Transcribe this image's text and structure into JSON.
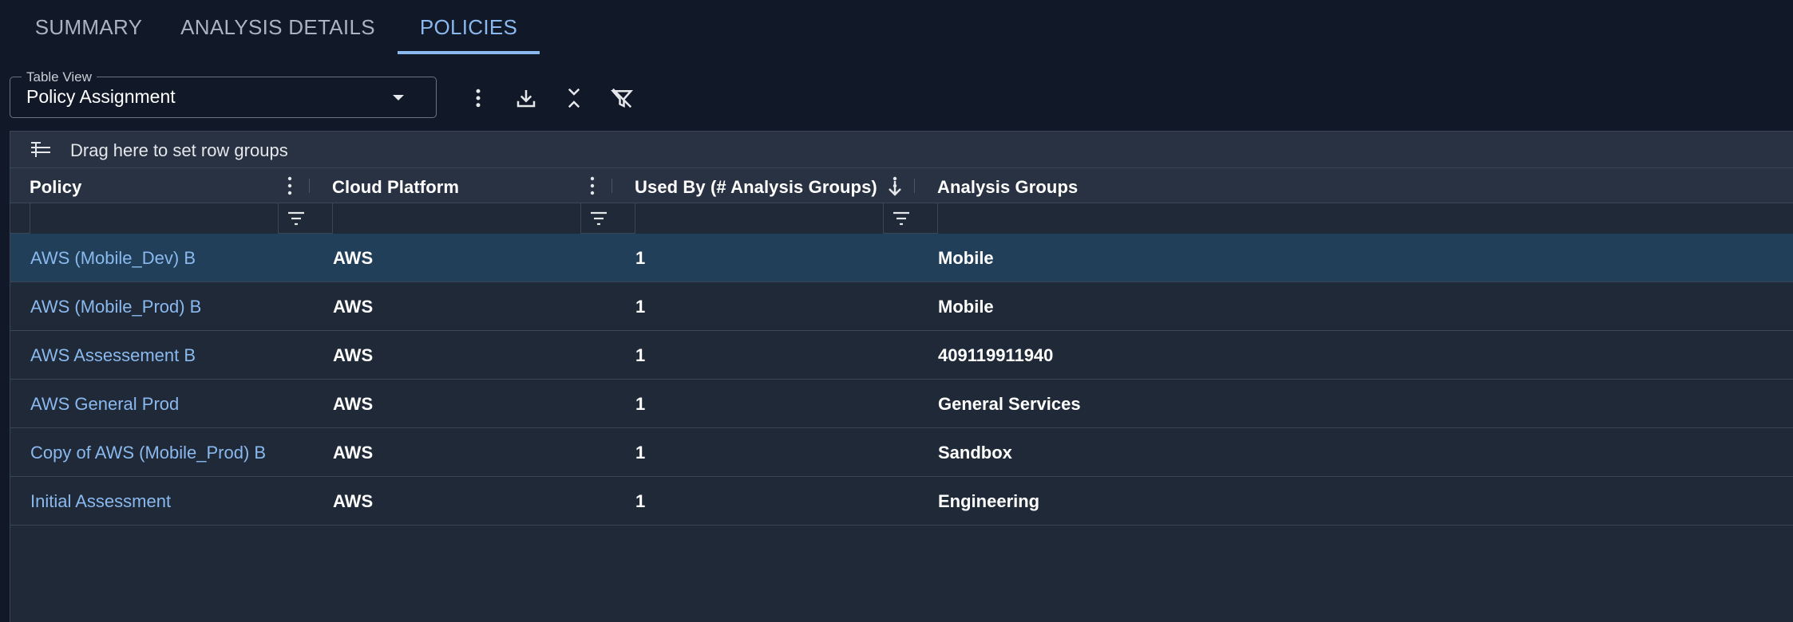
{
  "tabs": [
    {
      "label": "SUMMARY",
      "active": false
    },
    {
      "label": "ANALYSIS DETAILS",
      "active": false
    },
    {
      "label": "POLICIES",
      "active": true
    }
  ],
  "toolbar": {
    "view_legend": "Table View",
    "view_value": "Policy Assignment",
    "icons": [
      "more-vert-icon",
      "download-icon",
      "collapse-icon",
      "clear-filter-icon"
    ]
  },
  "grid": {
    "group_bar_text": "Drag here to set row groups",
    "columns": [
      {
        "label": "Policy"
      },
      {
        "label": "Cloud Platform"
      },
      {
        "label": "Used By (# Analysis Groups)",
        "sort": "desc"
      },
      {
        "label": "Analysis Groups"
      }
    ],
    "rows": [
      {
        "policy": "AWS (Mobile_Dev) B",
        "platform": "AWS",
        "used_by": "1",
        "groups": "Mobile",
        "selected": true
      },
      {
        "policy": "AWS (Mobile_Prod) B",
        "platform": "AWS",
        "used_by": "1",
        "groups": "Mobile"
      },
      {
        "policy": "AWS Assessement B",
        "platform": "AWS",
        "used_by": "1",
        "groups": "409119911940"
      },
      {
        "policy": "AWS General Prod",
        "platform": "AWS",
        "used_by": "1",
        "groups": "General Services"
      },
      {
        "policy": "Copy of AWS (Mobile_Prod) B",
        "platform": "AWS",
        "used_by": "1",
        "groups": "Sandbox"
      },
      {
        "policy": "Initial Assessment",
        "platform": "AWS",
        "used_by": "1",
        "groups": "Engineering"
      }
    ]
  },
  "colors": {
    "background": "#111827",
    "grid_background": "#1f2937",
    "header_background": "#283242",
    "selected_row": "#213f58",
    "accent": "#8ab9ef",
    "border": "#3a4556"
  }
}
